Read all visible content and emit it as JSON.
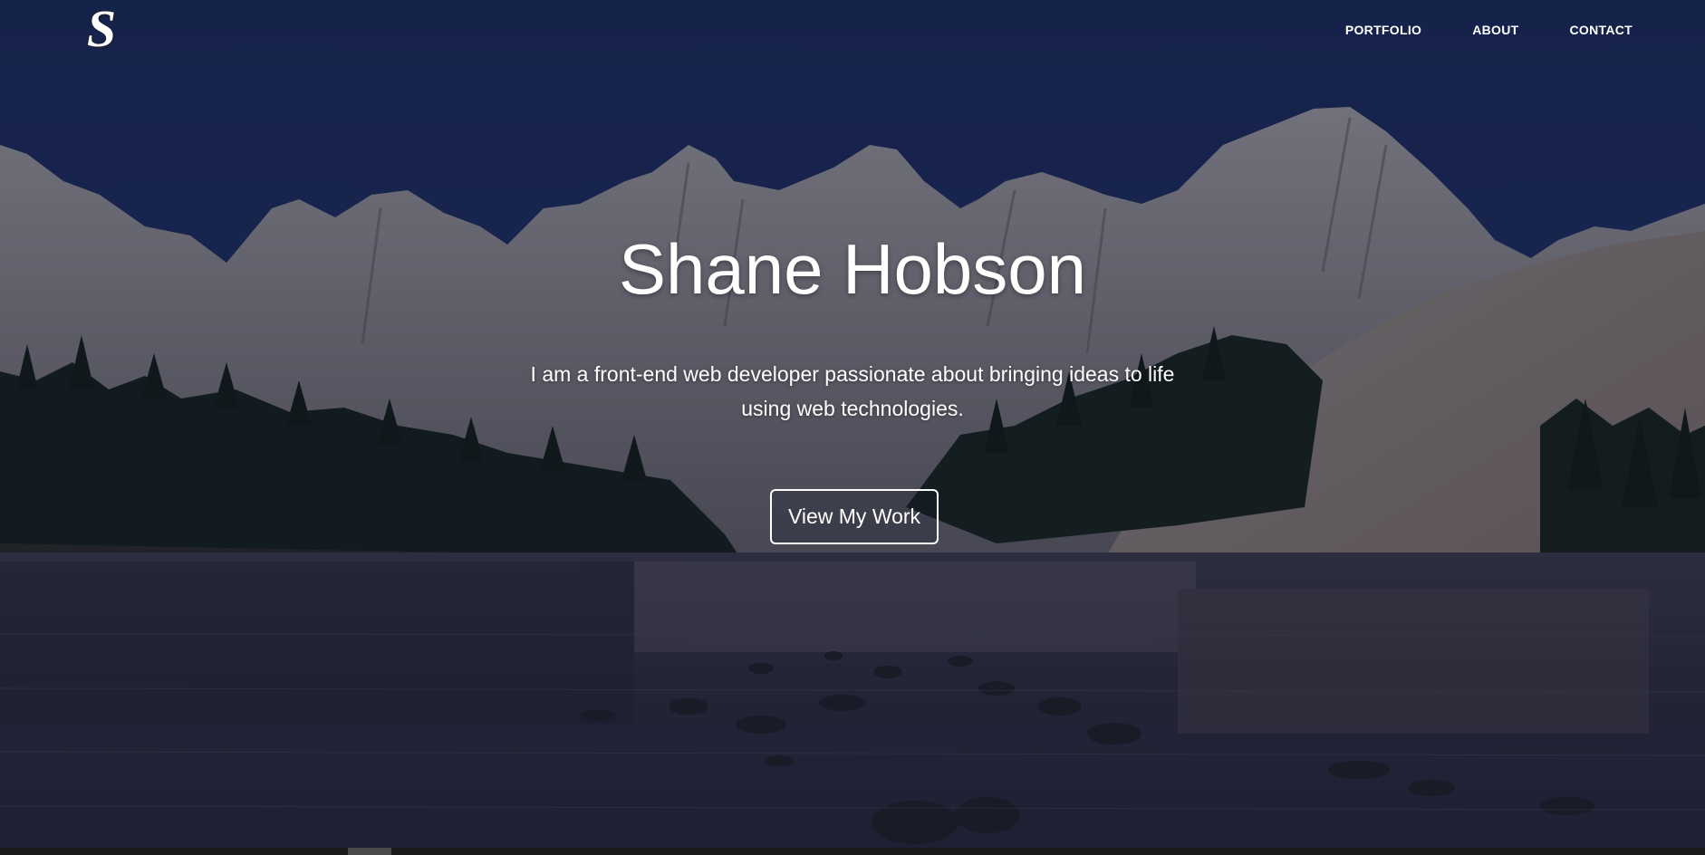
{
  "brand": {
    "logo_letter": "S"
  },
  "nav": {
    "items": [
      {
        "label": "PORTFOLIO"
      },
      {
        "label": "ABOUT"
      },
      {
        "label": "CONTACT"
      }
    ]
  },
  "hero": {
    "title": "Shane Hobson",
    "subtitle": "I am a front-end web developer passionate about bringing ideas to life using web technologies.",
    "cta_label": "View My Work"
  },
  "colors": {
    "sky": "#1c2c5c",
    "mountain": "#8a8a90",
    "forest": "#16221e",
    "lake": "#2e3040",
    "text": "#ffffff"
  }
}
